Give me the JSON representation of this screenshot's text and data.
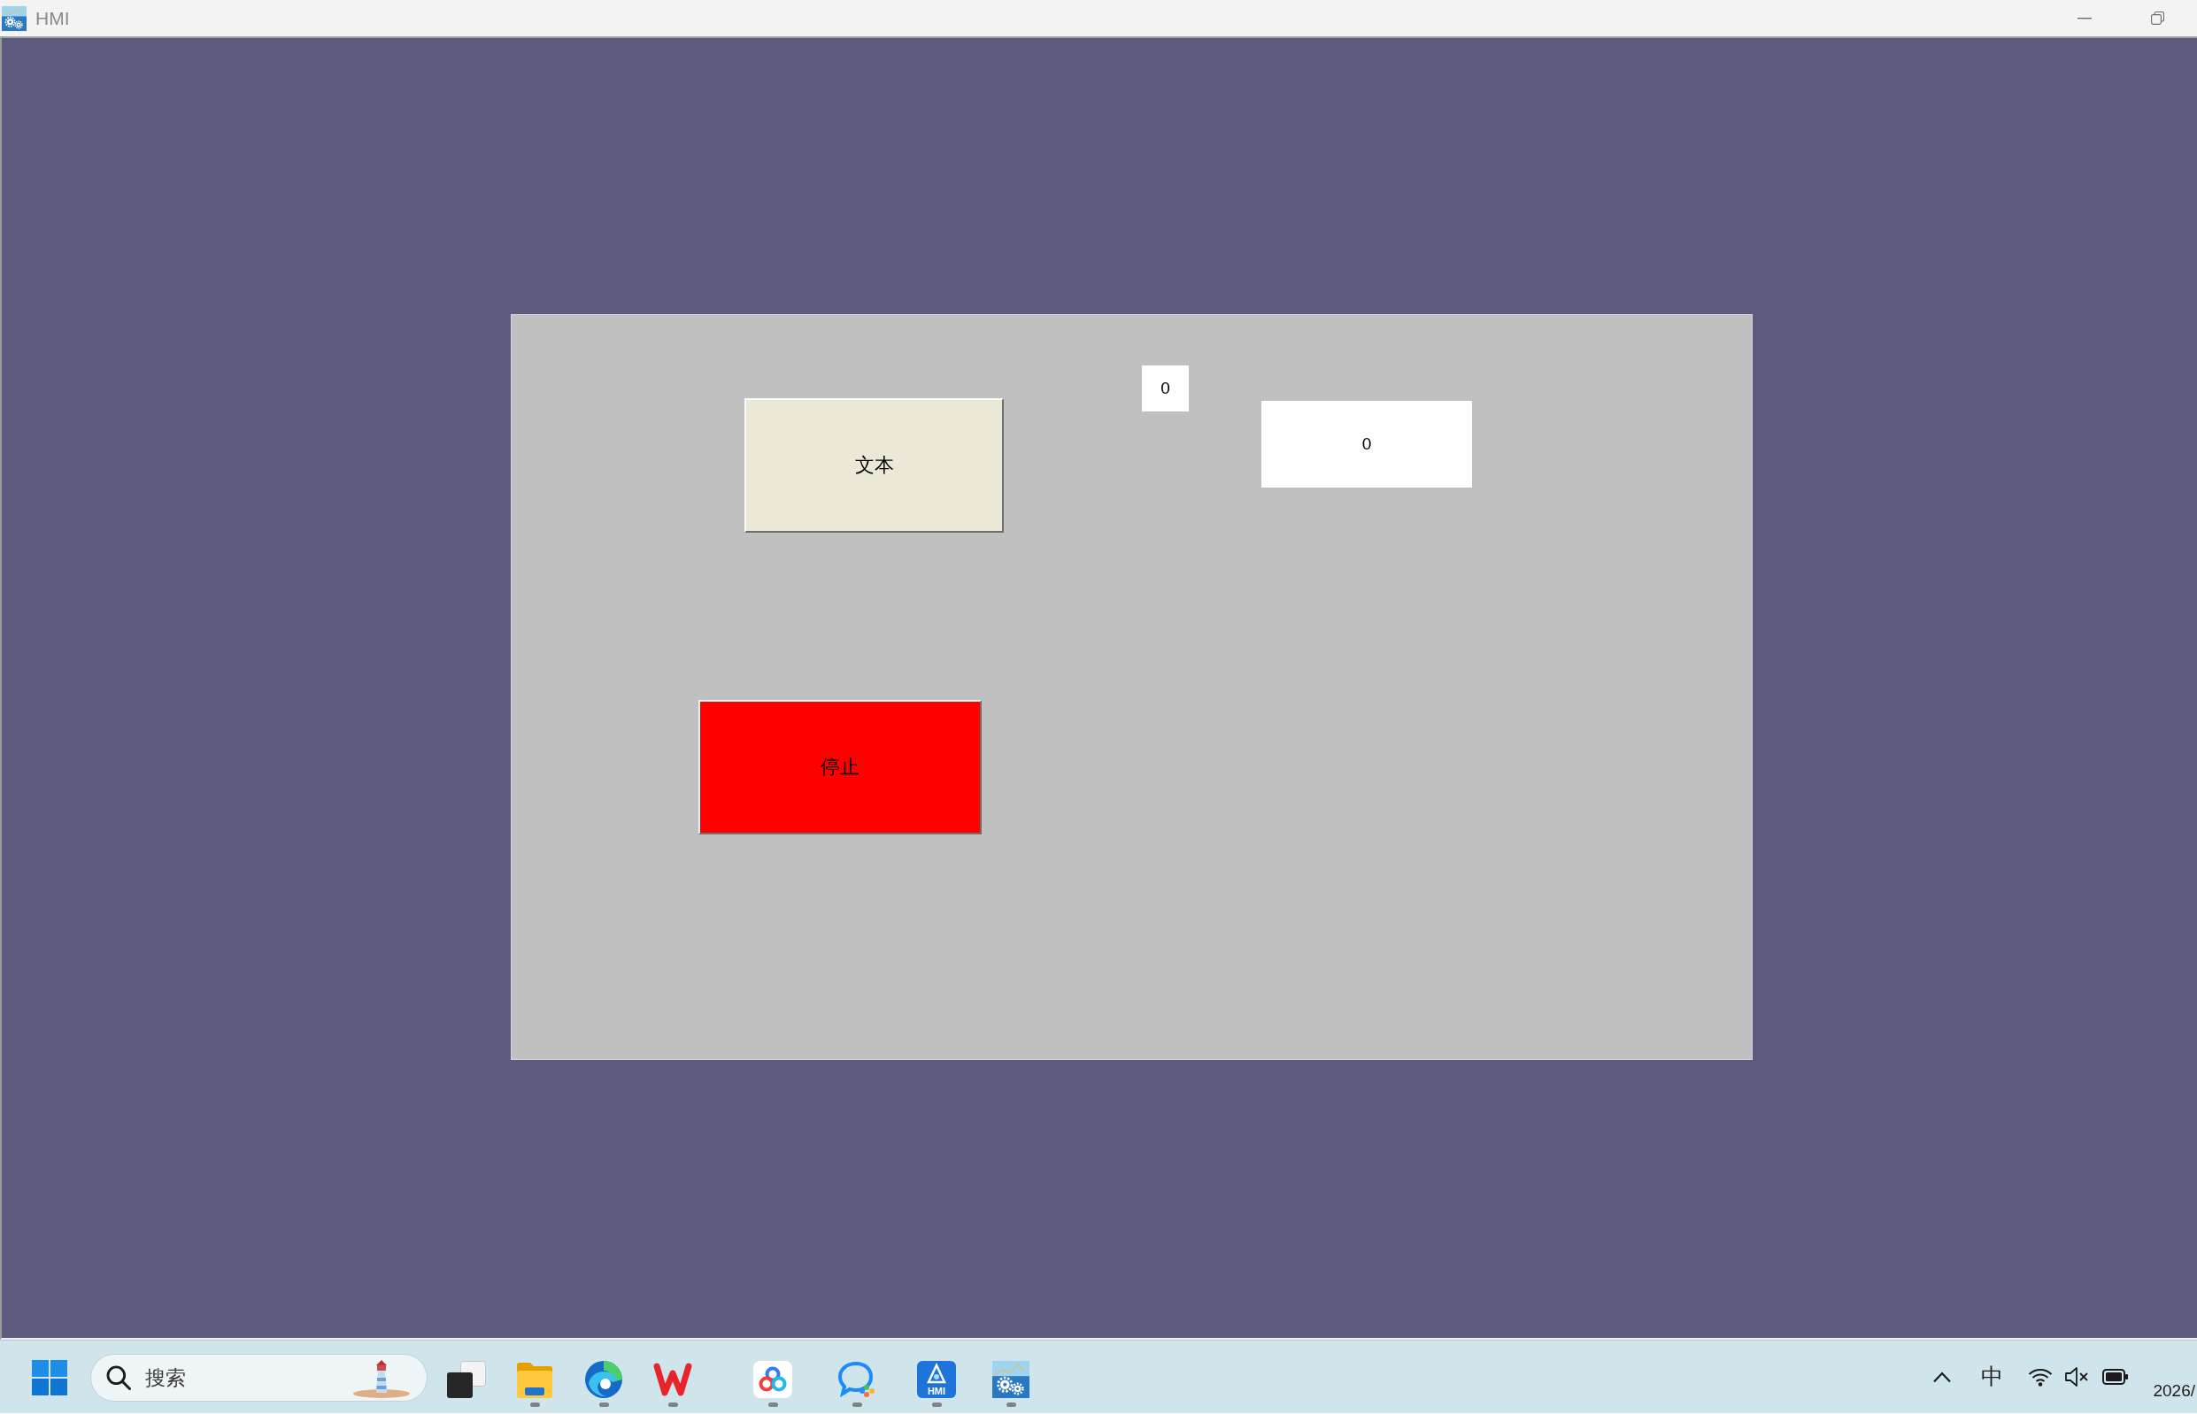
{
  "window": {
    "title": "HMI"
  },
  "screen": {
    "widgets": [
      {
        "kind": "button",
        "label": "文本",
        "color": "#ebe8d8"
      },
      {
        "kind": "display",
        "value": "0"
      },
      {
        "kind": "display",
        "value": "0"
      },
      {
        "kind": "button",
        "label": "停止",
        "color": "#ff0000"
      }
    ]
  },
  "taskbar": {
    "search": {
      "placeholder": "搜索"
    },
    "apps": [
      {
        "kind": "taskview",
        "running": false
      },
      {
        "kind": "explorer",
        "running": true
      },
      {
        "kind": "browser",
        "running": true
      },
      {
        "kind": "office",
        "running": true
      },
      {
        "kind": "cloud",
        "running": true
      },
      {
        "kind": "chat",
        "running": true
      },
      {
        "kind": "designer",
        "running": true,
        "label": "HMI"
      },
      {
        "kind": "runtime",
        "running": true
      }
    ],
    "tray": {
      "input_method": "中",
      "date": "2026/"
    }
  }
}
